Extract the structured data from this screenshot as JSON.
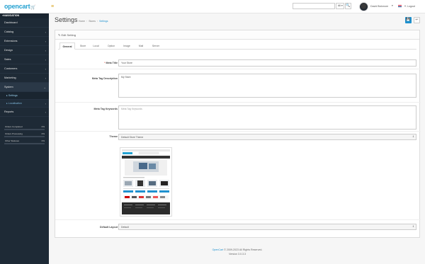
{
  "header": {
    "logo_text": "opencart",
    "logo_cart": "🛒",
    "search": {
      "placeholder": "",
      "filter_label": "All",
      "filter_caret": "▾",
      "button_icon": "🔍"
    },
    "user": {
      "name": "David Bickmore",
      "caret": "▾"
    },
    "logout_label": "Logout"
  },
  "sidebar": {
    "heading": "NAVIGATION",
    "items": [
      {
        "label": "Dashboard",
        "chev": ""
      },
      {
        "label": "Catalog",
        "chev": "›"
      },
      {
        "label": "Extensions",
        "chev": "›"
      },
      {
        "label": "Design",
        "chev": "›"
      },
      {
        "label": "Sales",
        "chev": "›"
      },
      {
        "label": "Customers",
        "chev": "›"
      },
      {
        "label": "Marketing",
        "chev": "›"
      },
      {
        "label": "System",
        "chev": "⌄"
      }
    ],
    "sub_items": [
      {
        "label": "▸ Settings",
        "chev": ""
      },
      {
        "label": "▸ Localisation",
        "chev": "›"
      }
    ],
    "reports_label": "Reports",
    "reports_chev": "›",
    "stats": [
      {
        "label": "Orders Completed",
        "percent": "0%",
        "value": 0
      },
      {
        "label": "Orders Processing",
        "percent": "0%",
        "value": 0
      },
      {
        "label": "Other Statuses",
        "percent": "0%",
        "value": 0
      }
    ]
  },
  "page": {
    "title": "Settings",
    "breadcrumb": [
      "Home",
      "Stores",
      "Settings"
    ],
    "breadcrumb_sep": "›",
    "save_icon": "💾",
    "back_icon": "↩"
  },
  "panel": {
    "heading": "✎ Edit Setting",
    "tabs": [
      "General",
      "Store",
      "Local",
      "Option",
      "Image",
      "Mail",
      "Server"
    ],
    "fields": {
      "meta_title": {
        "label": "Meta Title",
        "required": "*",
        "value": "Your Store"
      },
      "meta_description": {
        "label": "Meta Tag Description",
        "value": "My Store"
      },
      "meta_keywords": {
        "label": "Meta Tag Keywords",
        "placeholder": "Meta Tag Keywords"
      },
      "theme": {
        "label": "Theme",
        "value": "Default Store Theme",
        "caret": "⇕"
      },
      "default_layout": {
        "label": "Default Layout",
        "value": "Default",
        "caret": "⇕"
      }
    }
  },
  "footer": {
    "brand": "OpenCart",
    "copyright": " © 2009-2023 All Rights Reserved.",
    "version": "Version 3.0.3.3"
  },
  "colors": {
    "accent": "#1e91cf",
    "sidebar_bg": "#1e2a36",
    "required": "#e3503e"
  }
}
